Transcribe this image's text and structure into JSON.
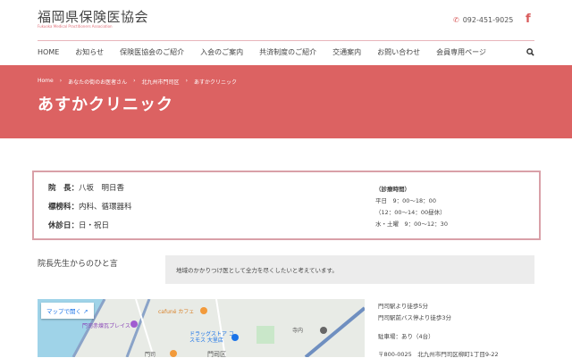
{
  "header": {
    "logo": "福岡県保険医協会",
    "logo_sub": "Fukuoka Medical Practitioners Association",
    "phone": "092-451-9025",
    "facebook": "f"
  },
  "nav": [
    "HOME",
    "お知らせ",
    "保険医協会のご紹介",
    "入会のご案内",
    "共済制度のご紹介",
    "交通案内",
    "お問い合わせ",
    "会員専用ページ"
  ],
  "breadcrumb": [
    "Home",
    "あなたの街のお医者さん",
    "北九州市門司区",
    "あすかクリニック"
  ],
  "page_title": "あすかクリニック",
  "info": {
    "director_label": "院　長：",
    "director": "八坂　明日香",
    "dept_label": "標榜科：",
    "dept": "内科、循環器科",
    "closed_label": "休診日：",
    "closed": "日・祝日",
    "hours_title": "（診療時間）",
    "hours": [
      "平日　9：00〜18：00",
      "（12：00〜14：00昼休）",
      "水・土曜　9：00〜12：30"
    ]
  },
  "message": {
    "label": "院長先生からのひと言",
    "text": "地域のかかりつけ医として全力を尽くしたいと考えています。"
  },
  "map": {
    "open_label": "マップで開く",
    "places": [
      "cafuné カフェ",
      "門司赤煉瓦プレイス",
      "ドラッグストア コスモス 大里店",
      "門司区",
      "寺内",
      "門司"
    ]
  },
  "access": [
    "門司駅より徒歩5分",
    "門司駅前バス停より徒歩3分",
    "駐車場：あり（4台）",
    "〒800-0025　北九州市門司区柳町1丁目9-22"
  ],
  "colors": {
    "accent": "#dc6262",
    "border": "#d9a0a8"
  }
}
